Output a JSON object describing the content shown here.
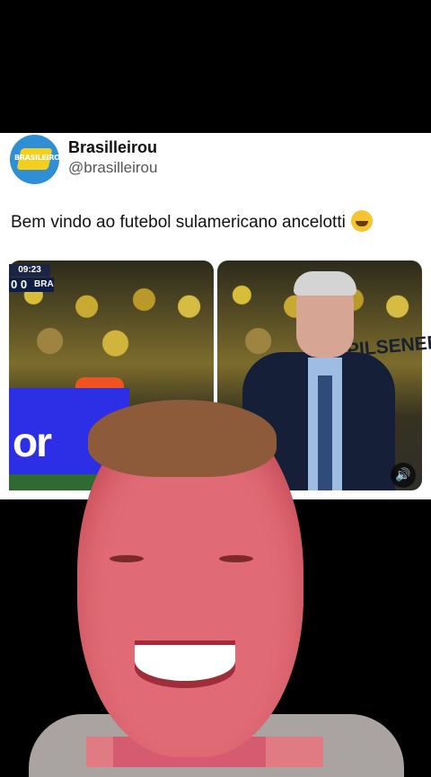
{
  "account": {
    "name": "Brasilleirou",
    "handle": "@brasilleirou",
    "logo_text": "BRASILEIROU"
  },
  "tweet": {
    "text": "Bem vindo ao futebol sulamericano ancelotti"
  },
  "media": {
    "left": {
      "time": "09:23",
      "score": "0 0",
      "team": "BRA",
      "board_text": "or"
    },
    "right": {
      "sponsor": "PILSENER"
    }
  },
  "icons": {
    "emoji": "laughing-crying-face",
    "speaker": "speaker-icon"
  }
}
